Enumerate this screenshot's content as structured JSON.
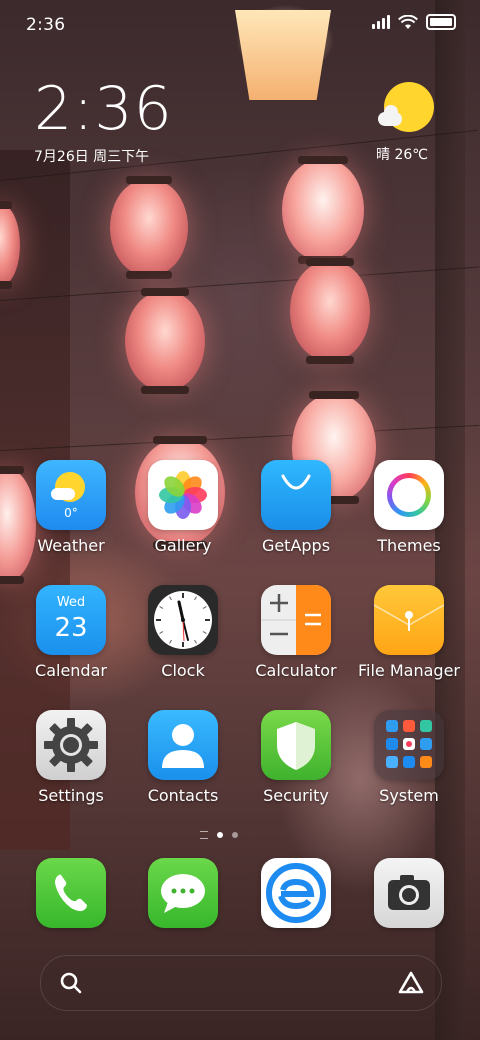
{
  "status_bar": {
    "time": "2:36"
  },
  "clock_widget": {
    "time": "2:36",
    "date": "7月26日 周三下午"
  },
  "weather_widget": {
    "text": "晴 26℃"
  },
  "apps": [
    {
      "id": "weather",
      "label": "Weather",
      "icon_text": "0°"
    },
    {
      "id": "gallery",
      "label": "Gallery"
    },
    {
      "id": "getapps",
      "label": "GetApps"
    },
    {
      "id": "themes",
      "label": "Themes"
    },
    {
      "id": "calendar",
      "label": "Calendar",
      "day_name": "Wed",
      "day_number": "23"
    },
    {
      "id": "clock",
      "label": "Clock"
    },
    {
      "id": "calculator",
      "label": "Calculator"
    },
    {
      "id": "file-manager",
      "label": "File Manager"
    },
    {
      "id": "settings",
      "label": "Settings"
    },
    {
      "id": "contacts",
      "label": "Contacts"
    },
    {
      "id": "security",
      "label": "Security"
    },
    {
      "id": "system",
      "label": "System"
    }
  ],
  "dock": [
    {
      "id": "phone",
      "icon": "phone-icon"
    },
    {
      "id": "messaging",
      "icon": "chat-bubble-icon"
    },
    {
      "id": "browser",
      "icon": "browser-e-icon"
    },
    {
      "id": "camera",
      "icon": "camera-icon"
    }
  ],
  "pager": {
    "pages": 2,
    "active": 1
  },
  "colors": {
    "accent_blue": "#1e9bf0",
    "weather_sun": "#ffd52e",
    "security_green": "#5fcf3e",
    "file_manager_yellow": "#ffb21a",
    "calculator_orange": "#ff8a1a"
  }
}
